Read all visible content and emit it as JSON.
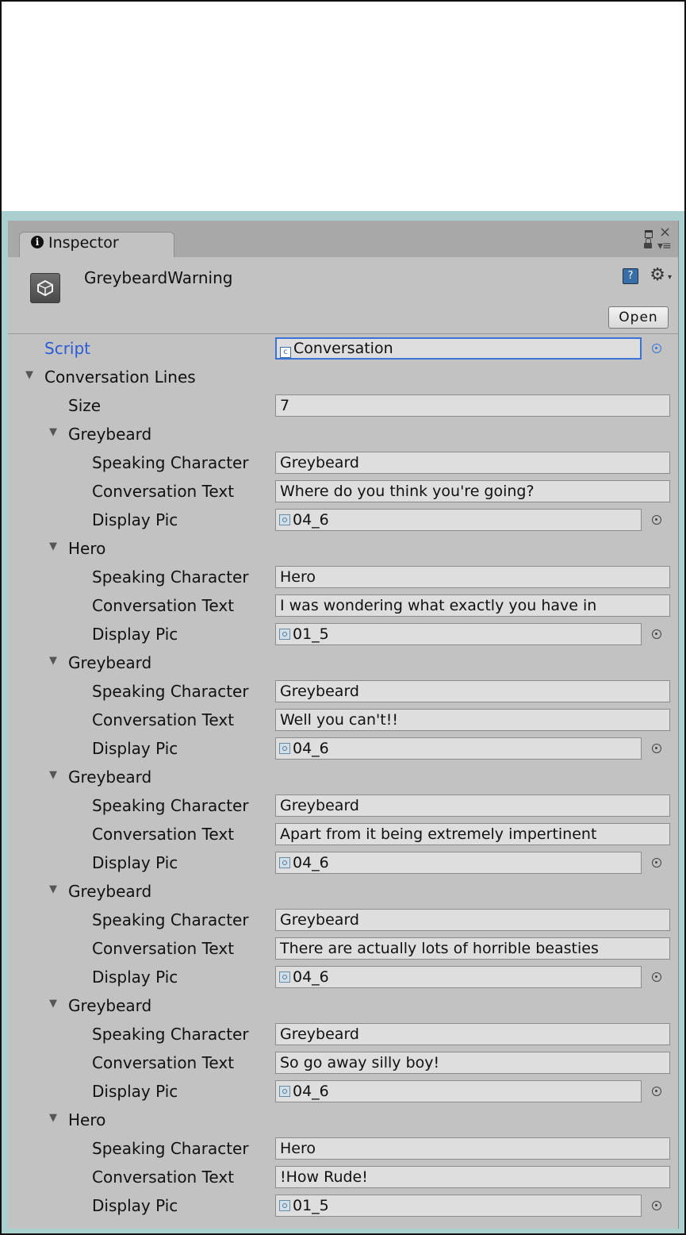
{
  "inspector": {
    "tab_label": "Inspector",
    "asset_title": "GreybeardWarning",
    "open_label": "Open",
    "help_label": "?"
  },
  "script": {
    "label": "Script",
    "value": "Conversation"
  },
  "conversation_lines": {
    "label": "Conversation Lines",
    "size_label": "Size",
    "size_value": "7",
    "field_labels": {
      "speaking_character": "Speaking Character",
      "conversation_text": "Conversation Text",
      "display_pic": "Display Pic"
    },
    "items": [
      {
        "title": "Greybeard",
        "speaking_character": "Greybeard",
        "conversation_text": "Where do you think you're going?",
        "display_pic": "04_6"
      },
      {
        "title": "Hero",
        "speaking_character": "Hero",
        "conversation_text": "I was wondering what exactly you have in",
        "display_pic": "01_5"
      },
      {
        "title": "Greybeard",
        "speaking_character": "Greybeard",
        "conversation_text": "Well you can't!!",
        "display_pic": "04_6"
      },
      {
        "title": "Greybeard",
        "speaking_character": "Greybeard",
        "conversation_text": "Apart from it being extremely impertinent",
        "display_pic": "04_6"
      },
      {
        "title": "Greybeard",
        "speaking_character": "Greybeard",
        "conversation_text": "There are actually lots of horrible beasties",
        "display_pic": "04_6"
      },
      {
        "title": "Greybeard",
        "speaking_character": "Greybeard",
        "conversation_text": "So go away silly boy!",
        "display_pic": "04_6"
      },
      {
        "title": "Hero",
        "speaking_character": "Hero",
        "conversation_text": "!How Rude!",
        "display_pic": "01_5"
      }
    ]
  }
}
